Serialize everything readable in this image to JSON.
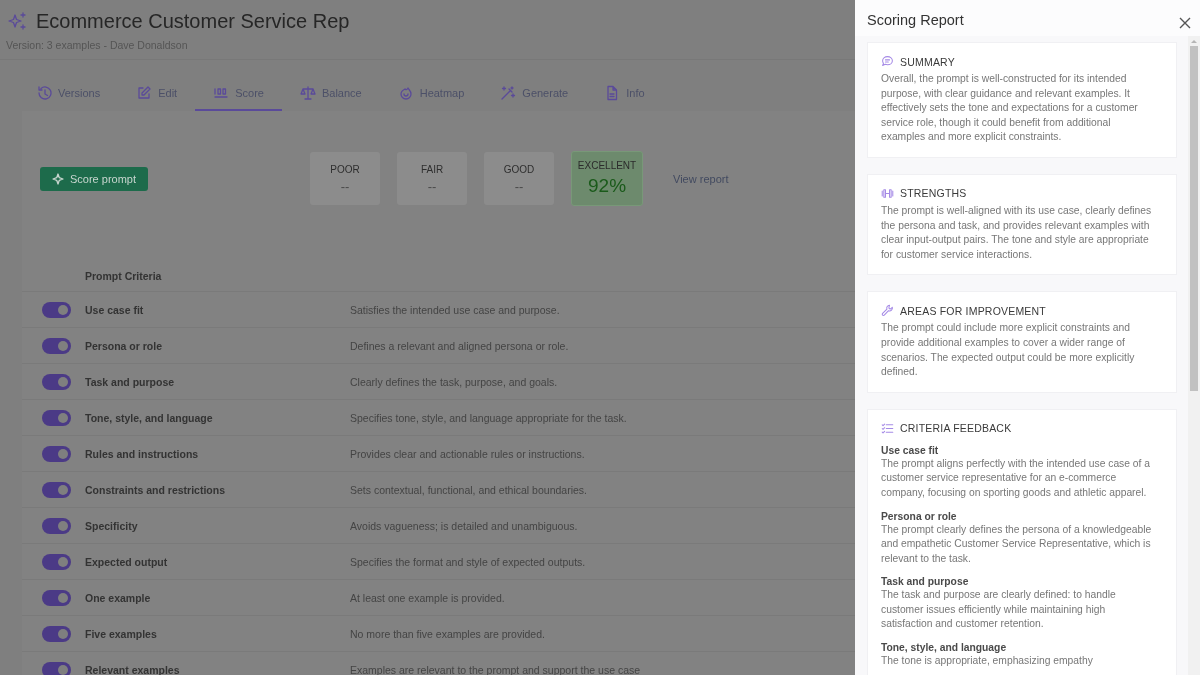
{
  "header": {
    "title": "Ecommerce Customer Service Rep",
    "subtitle": "Version: 3 examples - Dave Donaldson"
  },
  "tabs": [
    {
      "label": "Versions",
      "selected": false
    },
    {
      "label": "Edit",
      "selected": false
    },
    {
      "label": "Score",
      "selected": true
    },
    {
      "label": "Balance",
      "selected": false
    },
    {
      "label": "Heatmap",
      "selected": false
    },
    {
      "label": "Generate",
      "selected": false
    },
    {
      "label": "Info",
      "selected": false
    }
  ],
  "score_button": "Score prompt",
  "ratings": [
    {
      "label": "POOR",
      "value": "--",
      "selected": false
    },
    {
      "label": "FAIR",
      "value": "--",
      "selected": false
    },
    {
      "label": "GOOD",
      "value": "--",
      "selected": false
    },
    {
      "label": "EXCELLENT",
      "value": "92%",
      "selected": true
    }
  ],
  "view_report": "View report",
  "criteria": {
    "header": "Prompt Criteria",
    "rows": [
      {
        "name": "Use case fit",
        "description": "Satisfies the intended use case and purpose.",
        "on": true
      },
      {
        "name": "Persona or role",
        "description": "Defines a relevant and aligned persona or role.",
        "on": true
      },
      {
        "name": "Task and purpose",
        "description": "Clearly defines the task, purpose, and goals.",
        "on": true
      },
      {
        "name": "Tone, style, and language",
        "description": "Specifies tone, style, and language appropriate for the task.",
        "on": true
      },
      {
        "name": "Rules and instructions",
        "description": "Provides clear and actionable rules or instructions.",
        "on": true
      },
      {
        "name": "Constraints and restrictions",
        "description": "Sets contextual, functional, and ethical boundaries.",
        "on": true
      },
      {
        "name": "Specificity",
        "description": "Avoids vagueness; is detailed and unambiguous.",
        "on": true
      },
      {
        "name": "Expected output",
        "description": "Specifies the format and style of expected outputs.",
        "on": true
      },
      {
        "name": "One example",
        "description": "At least one example is provided.",
        "on": true
      },
      {
        "name": "Five examples",
        "description": "No more than five examples are provided.",
        "on": true
      },
      {
        "name": "Relevant examples",
        "description": "Examples are relevant to the prompt and support the use case",
        "on": true
      }
    ]
  },
  "report": {
    "title": "Scoring Report",
    "sections": [
      {
        "kind": "text",
        "heading": "SUMMARY",
        "body": "Overall, the prompt is well-constructed for its intended purpose, with clear guidance and relevant examples. It effectively sets the tone and expectations for a customer service role, though it could benefit from additional examples and more explicit constraints."
      },
      {
        "kind": "text",
        "heading": "STRENGTHS",
        "body": "The prompt is well-aligned with its use case, clearly defines the persona and task, and provides relevant examples with clear input-output pairs. The tone and style are appropriate for customer service interactions."
      },
      {
        "kind": "text",
        "heading": "AREAS FOR IMPROVEMENT",
        "body": "The prompt could include more explicit constraints and provide additional examples to cover a wider range of scenarios. The expected output could be more explicitly defined."
      },
      {
        "kind": "feedback",
        "heading": "CRITERIA FEEDBACK",
        "items": [
          {
            "name": "Use case fit",
            "text": "The prompt aligns perfectly with the intended use case of a customer service representative for an e-commerce company, focusing on sporting goods and athletic apparel."
          },
          {
            "name": "Persona or role",
            "text": "The prompt clearly defines the persona of a knowledgeable and empathetic Customer Service Representative, which is relevant to the task."
          },
          {
            "name": "Task and purpose",
            "text": "The task and purpose are clearly defined: to handle customer issues efficiently while maintaining high satisfaction and customer retention."
          },
          {
            "name": "Tone, style, and language",
            "text": "The tone is appropriate, emphasizing empathy"
          }
        ]
      }
    ]
  }
}
